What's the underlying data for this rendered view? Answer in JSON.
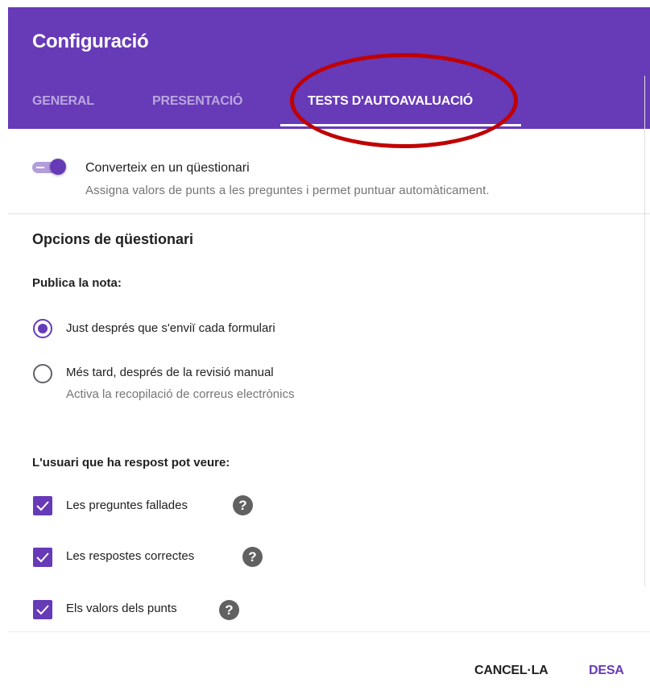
{
  "dialog": {
    "title": "Configuració",
    "tabs": [
      {
        "label": "GENERAL",
        "active": false
      },
      {
        "label": "PRESENTACIÓ",
        "active": false
      },
      {
        "label": "TESTS D'AUTOAVALUACIÓ",
        "active": true
      }
    ],
    "annotation_color": "#c00000",
    "accent_color": "#673ab7"
  },
  "quiz_toggle": {
    "label": "Converteix en un qüestionari",
    "description": "Assigna valors de punts a les preguntes i permet puntuar automàticament.",
    "on": true
  },
  "quiz_options": {
    "title": "Opcions de qüestionari",
    "release": {
      "title": "Publica la nota:",
      "options": [
        {
          "label": "Just després que s'enviï cada formulari",
          "selected": true
        },
        {
          "label": "Més tard, després de la revisió manual",
          "sublabel": "Activa la recopilació de correus electrònics",
          "selected": false
        }
      ]
    },
    "viewer": {
      "title": "L'usuari que ha respost pot veure:",
      "items": [
        {
          "label": "Les preguntes fallades",
          "checked": true,
          "help_icon": "?"
        },
        {
          "label": "Les respostes correctes",
          "checked": true,
          "help_icon": "?"
        },
        {
          "label": "Els valors dels punts",
          "checked": true,
          "help_icon": "?"
        }
      ]
    }
  },
  "footer": {
    "cancel_label": "CANCEL·LA",
    "save_label": "DESA"
  }
}
